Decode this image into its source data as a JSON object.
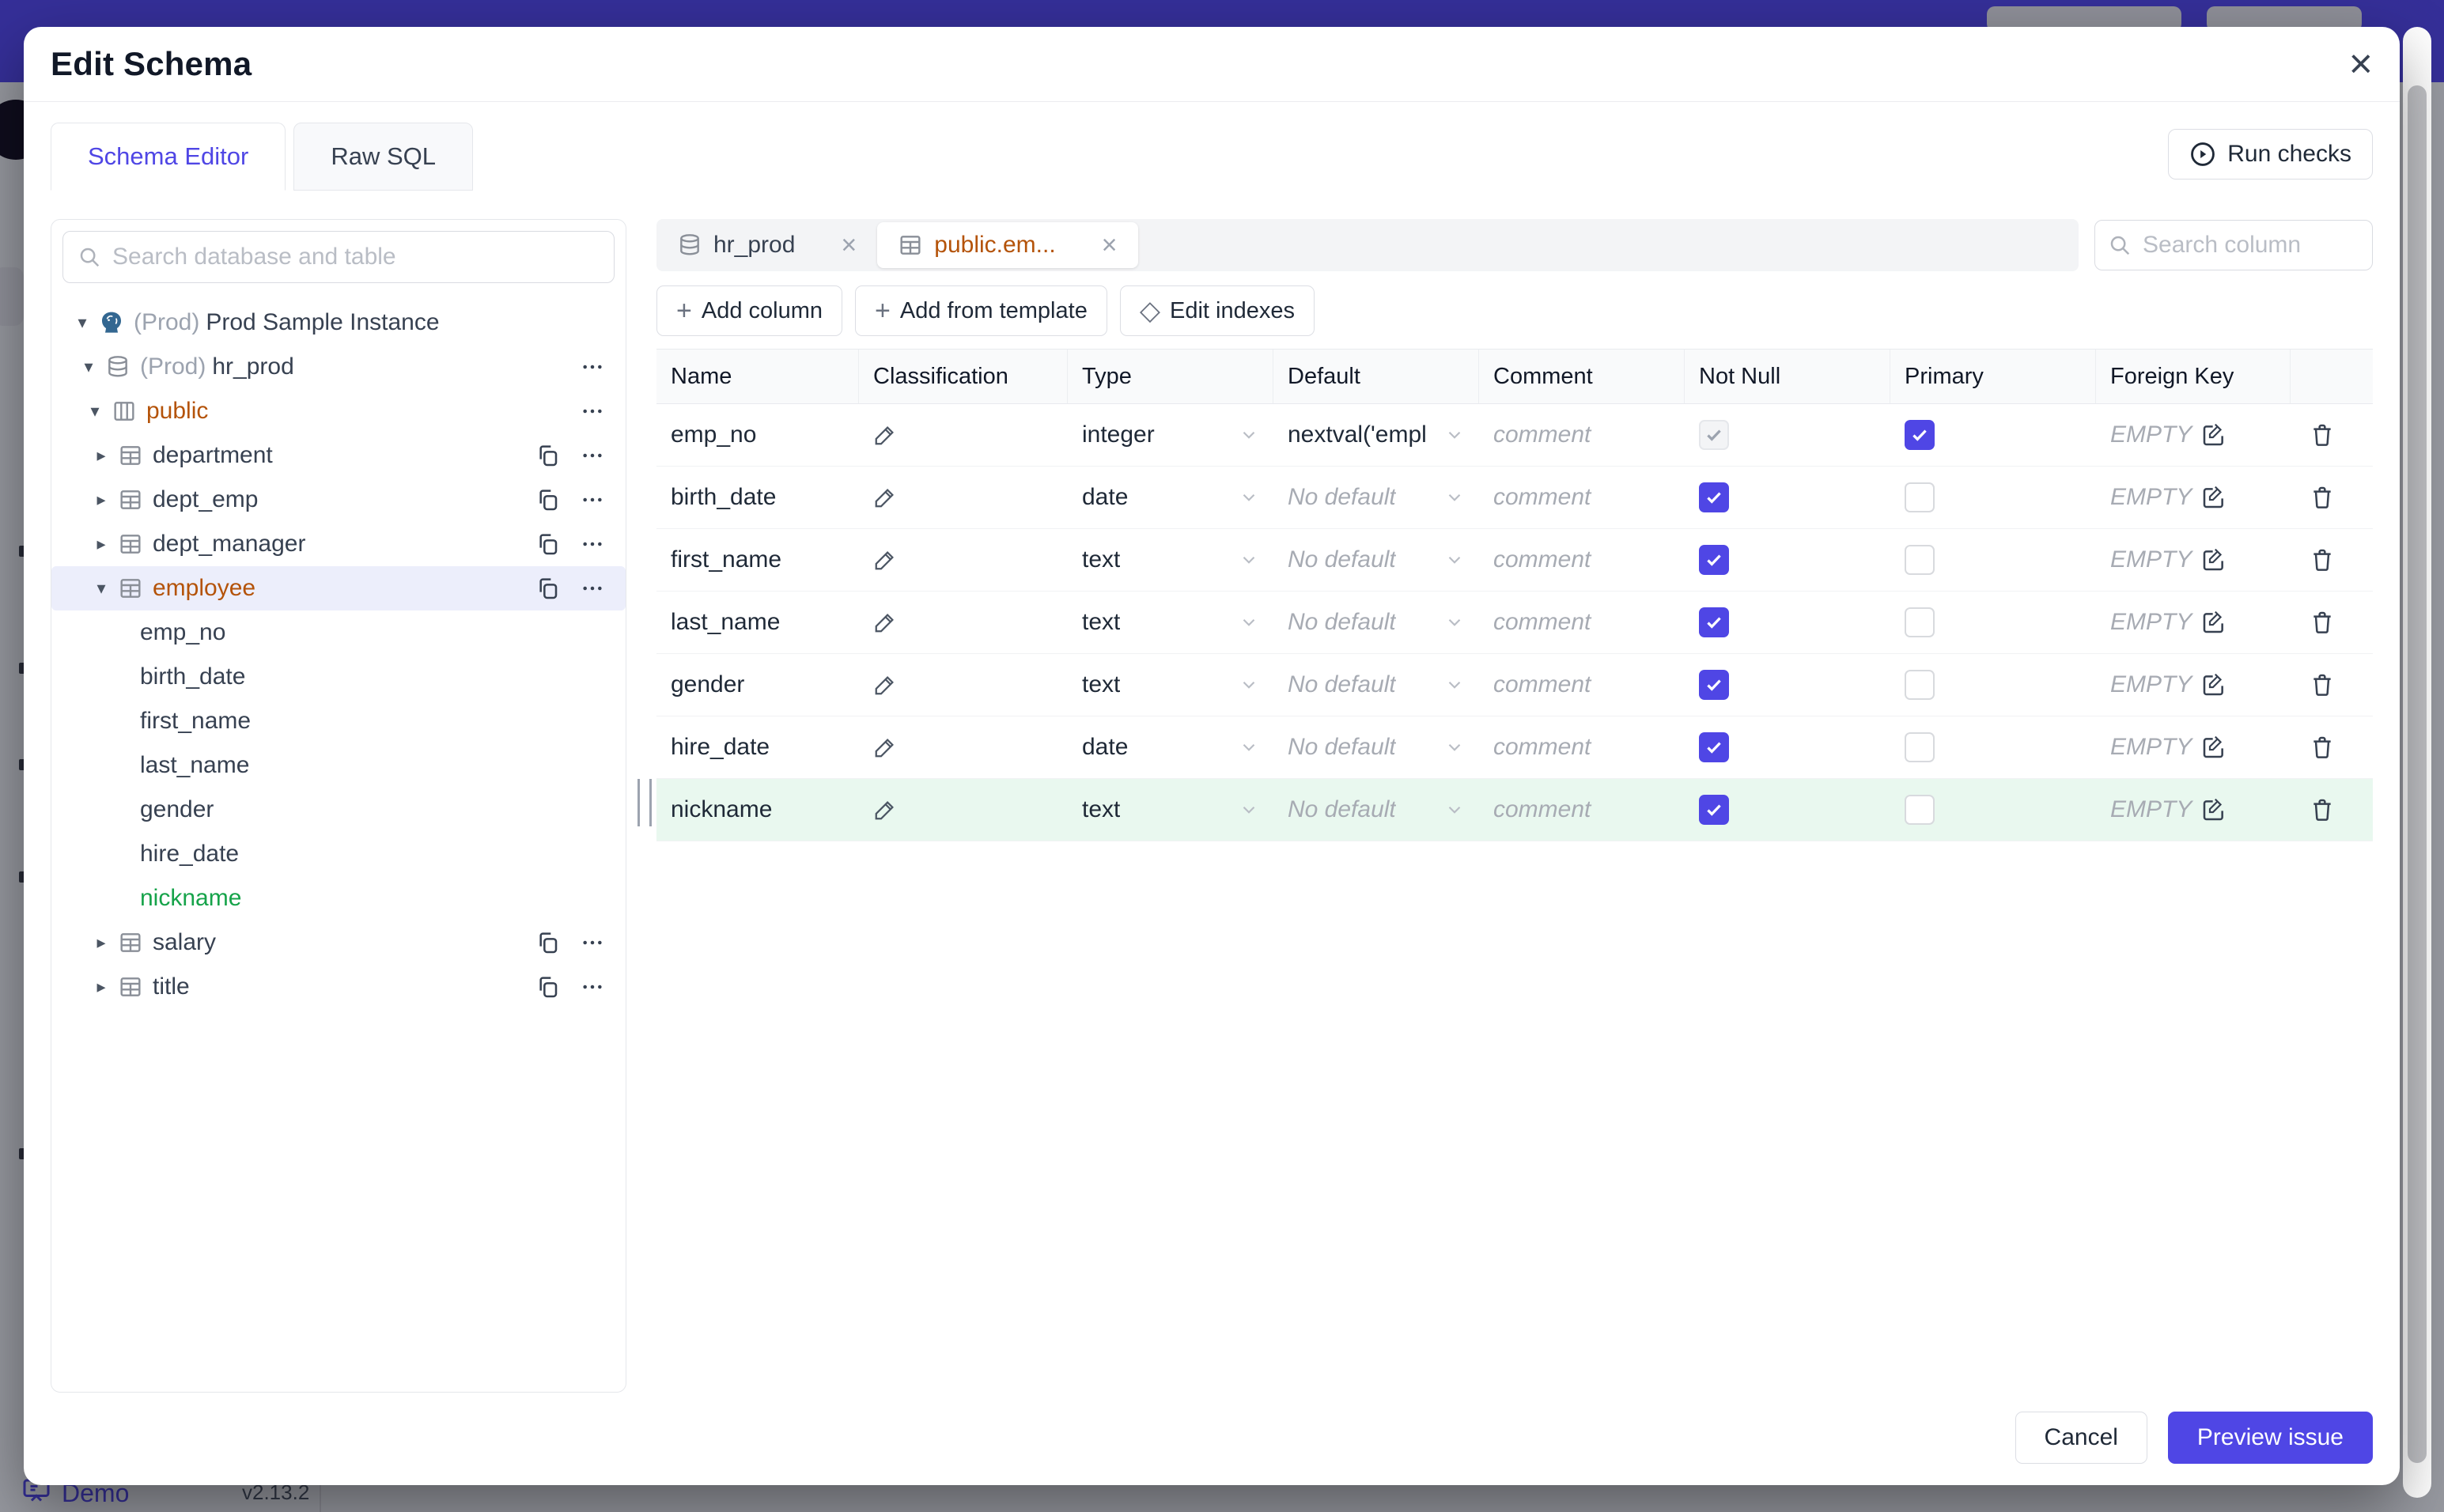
{
  "backdrop": {
    "demo_label": "Demo",
    "version": "v2.13.2"
  },
  "modal": {
    "title": "Edit Schema",
    "close_icon": "×"
  },
  "top_tabs": [
    {
      "label": "Schema Editor",
      "active": true
    },
    {
      "label": "Raw SQL",
      "active": false
    }
  ],
  "run_checks_label": "Run checks",
  "sidebar": {
    "search_placeholder": "Search database and table",
    "tree": [
      {
        "label": "Prod Sample Instance",
        "prefix": "(Prod)",
        "type": "instance",
        "arrow": "down"
      },
      {
        "label": "hr_prod",
        "prefix": "(Prod)",
        "type": "database",
        "arrow": "down",
        "menu": true
      },
      {
        "label": "public",
        "type": "schema",
        "arrow": "down",
        "accent": "orange",
        "menu": true
      },
      {
        "label": "department",
        "type": "table",
        "arrow": "right",
        "copy": true,
        "menu": true
      },
      {
        "label": "dept_emp",
        "type": "table",
        "arrow": "right",
        "copy": true,
        "menu": true
      },
      {
        "label": "dept_manager",
        "type": "table",
        "arrow": "right",
        "copy": true,
        "menu": true
      },
      {
        "label": "employee",
        "type": "table",
        "arrow": "down",
        "accent": "orange",
        "selected": true,
        "copy": true,
        "menu": true
      },
      {
        "label": "emp_no",
        "type": "column"
      },
      {
        "label": "birth_date",
        "type": "column"
      },
      {
        "label": "first_name",
        "type": "column"
      },
      {
        "label": "last_name",
        "type": "column"
      },
      {
        "label": "gender",
        "type": "column"
      },
      {
        "label": "hire_date",
        "type": "column"
      },
      {
        "label": "nickname",
        "type": "column",
        "accent": "green"
      },
      {
        "label": "salary",
        "type": "table",
        "arrow": "right",
        "copy": true,
        "menu": true
      },
      {
        "label": "title",
        "type": "table",
        "arrow": "right",
        "copy": true,
        "menu": true
      }
    ]
  },
  "editor": {
    "open_tabs": [
      {
        "label": "hr_prod",
        "icon": "database",
        "active": false
      },
      {
        "label": "public.em...",
        "icon": "table",
        "active": true
      }
    ],
    "column_search_placeholder": "Search column",
    "actions": [
      {
        "label": "Add column",
        "icon": "plus"
      },
      {
        "label": "Add from template",
        "icon": "plus"
      },
      {
        "label": "Edit indexes",
        "icon": "diamond"
      }
    ],
    "header_columns": [
      "Name",
      "Classification",
      "Type",
      "Default",
      "Comment",
      "Not Null",
      "Primary",
      "Foreign Key"
    ],
    "rows": [
      {
        "name": "emp_no",
        "type": "integer",
        "default_value": "nextval('employ",
        "default_muted": false,
        "comment_placeholder": "comment",
        "not_null": "disabled-checked",
        "primary": "checked",
        "foreign_key": "EMPTY",
        "highlight": false
      },
      {
        "name": "birth_date",
        "type": "date",
        "default_value": "No default",
        "default_muted": true,
        "comment_placeholder": "comment",
        "not_null": "checked",
        "primary": "unchecked",
        "foreign_key": "EMPTY",
        "highlight": false
      },
      {
        "name": "first_name",
        "type": "text",
        "default_value": "No default",
        "default_muted": true,
        "comment_placeholder": "comment",
        "not_null": "checked",
        "primary": "unchecked",
        "foreign_key": "EMPTY",
        "highlight": false
      },
      {
        "name": "last_name",
        "type": "text",
        "default_value": "No default",
        "default_muted": true,
        "comment_placeholder": "comment",
        "not_null": "checked",
        "primary": "unchecked",
        "foreign_key": "EMPTY",
        "highlight": false
      },
      {
        "name": "gender",
        "type": "text",
        "default_value": "No default",
        "default_muted": true,
        "comment_placeholder": "comment",
        "not_null": "checked",
        "primary": "unchecked",
        "foreign_key": "EMPTY",
        "highlight": false
      },
      {
        "name": "hire_date",
        "type": "date",
        "default_value": "No default",
        "default_muted": true,
        "comment_placeholder": "comment",
        "not_null": "checked",
        "primary": "unchecked",
        "foreign_key": "EMPTY",
        "highlight": false
      },
      {
        "name": "nickname",
        "type": "text",
        "default_value": "No default",
        "default_muted": true,
        "comment_placeholder": "comment",
        "not_null": "checked",
        "primary": "unchecked",
        "foreign_key": "EMPTY",
        "highlight": true
      }
    ]
  },
  "footer": {
    "cancel_label": "Cancel",
    "primary_label": "Preview issue"
  },
  "colors": {
    "accent_indigo": "#4f46e5",
    "table_accent_orange": "#b45309",
    "new_column_green": "#16a34a",
    "new_row_bg": "#e9f8ef",
    "selected_row_bg": "#eceefb",
    "banner_indigo": "#4f46e5"
  }
}
